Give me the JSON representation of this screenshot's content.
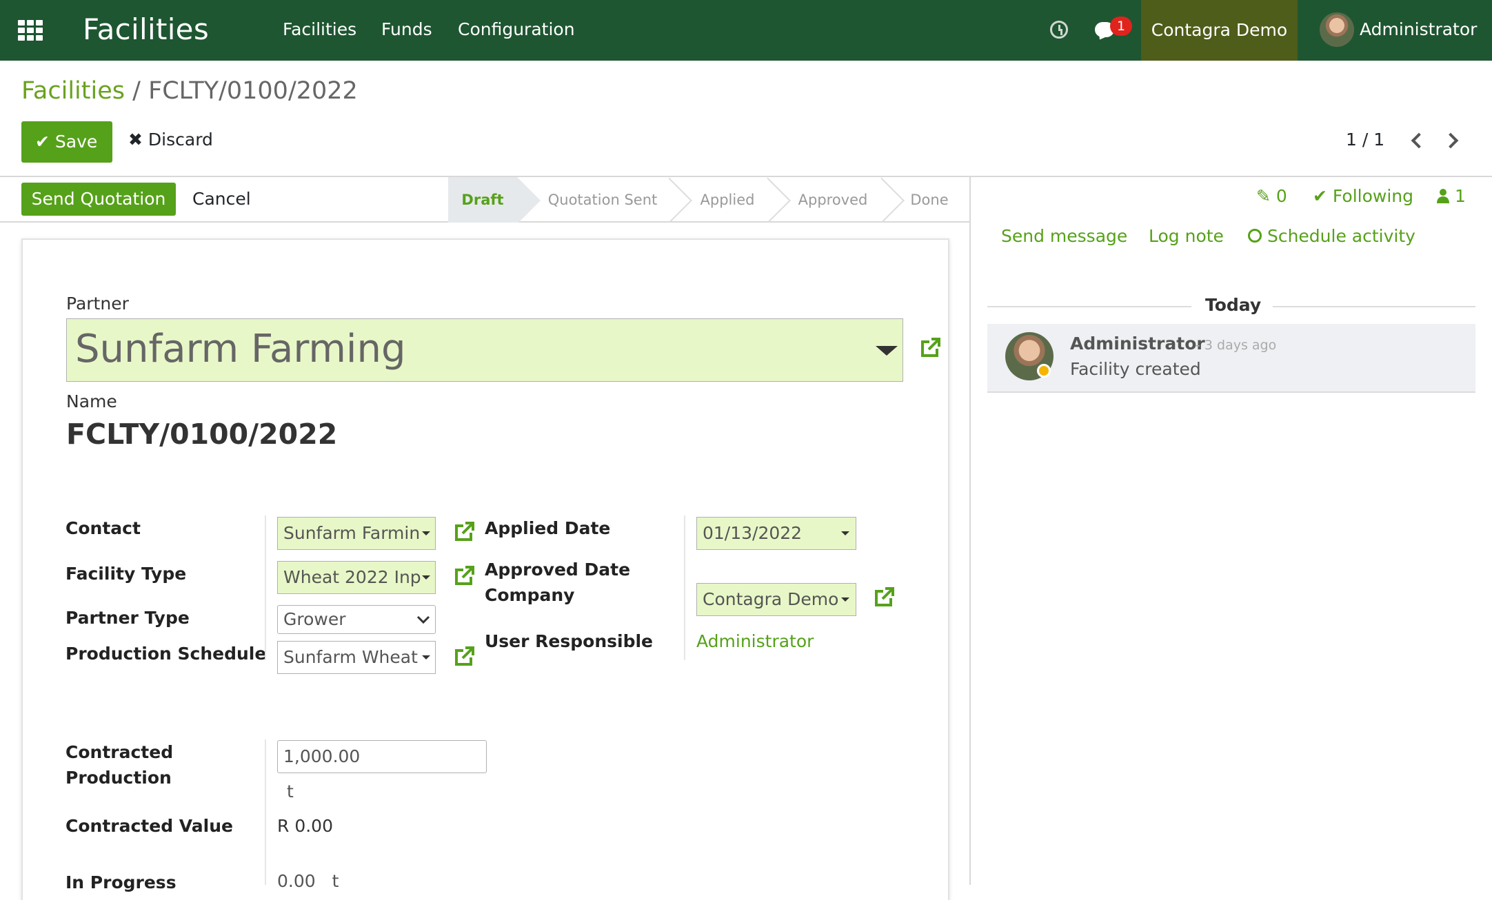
{
  "navbar": {
    "app_title": "Facilities",
    "menu": [
      "Facilities",
      "Funds",
      "Configuration"
    ],
    "messages_badge": "1",
    "company": "Contagra Demo",
    "user": "Administrator"
  },
  "breadcrumb": {
    "parent": "Facilities",
    "separator": "/",
    "current": "FCLTY/0100/2022"
  },
  "control_panel": {
    "save": "Save",
    "discard": "Discard",
    "pager": "1 / 1"
  },
  "statusbar": {
    "send_quotation": "Send Quotation",
    "cancel": "Cancel",
    "stages": [
      "Draft",
      "Quotation Sent",
      "Applied",
      "Approved",
      "Done"
    ],
    "active_stage": "Draft"
  },
  "form": {
    "partner_label": "Partner",
    "partner_value": "Sunfarm Farming",
    "name_label": "Name",
    "name_value": "FCLTY/0100/2022",
    "contact_label": "Contact",
    "contact_value": "Sunfarm Farmin",
    "facility_type_label": "Facility Type",
    "facility_type_value": "Wheat 2022 Inp",
    "partner_type_label": "Partner Type",
    "partner_type_value": "Grower",
    "production_schedule_label": "Production Schedule",
    "production_schedule_value": "Sunfarm Wheat",
    "applied_date_label": "Applied Date",
    "applied_date_value": "01/13/2022",
    "approved_date_label": "Approved Date",
    "company_label": "Company",
    "company_value": "Contagra Demo",
    "user_responsible_label": "User Responsible",
    "user_responsible_value": "Administrator",
    "contracted_production_label": "Contracted Production",
    "contracted_production_value": "1,000.00",
    "contracted_production_unit": "t",
    "contracted_value_label": "Contracted Value",
    "contracted_value_value": "R 0.00",
    "in_progress_label": "In Progress",
    "in_progress_value": "0.00",
    "in_progress_unit": "t"
  },
  "chatter": {
    "attachments_count": "0",
    "following": "Following",
    "followers_count": "1",
    "send_message": "Send message",
    "log_note": "Log note",
    "schedule_activity": "Schedule activity",
    "date_separator": "Today",
    "message": {
      "author": "Administrator",
      "date": "- 3 days ago",
      "body": "Facility created"
    }
  },
  "colors": {
    "navbar": "#1e5631",
    "company_bg": "#4e5d1a",
    "primary": "#56a11a",
    "required_field": "#e8f7c7"
  }
}
